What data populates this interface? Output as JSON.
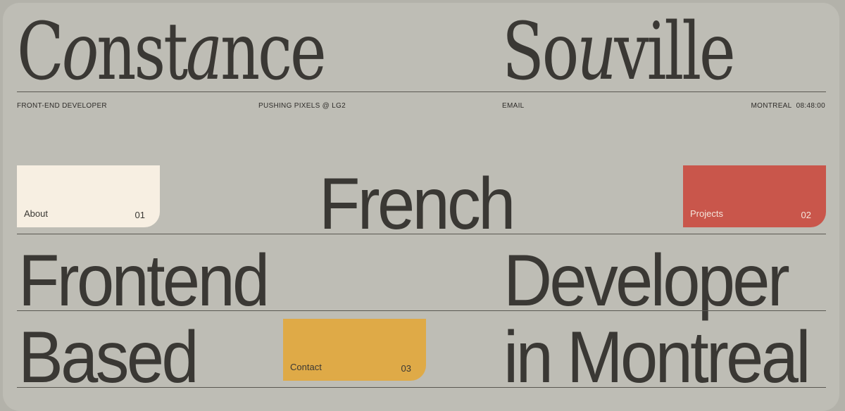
{
  "header": {
    "first_name": {
      "upright_start": "C",
      "italic_a": "o",
      "upright_mid": "nst",
      "italic_b": "a",
      "upright_end": "nce"
    },
    "last_name": {
      "upright_start": "So",
      "italic_a": "u",
      "upright_end": "ville"
    }
  },
  "info_bar": {
    "role": "FRONT-END DEVELOPER",
    "tagline": "PUSHING PIXELS @ LG2",
    "email": "EMAIL",
    "location": "MONTREAL",
    "clock": "08:48:00"
  },
  "headline": {
    "line1": "French",
    "line2_left": "Frontend",
    "line2_right": "Developer",
    "line3_left": "Based",
    "line3_right": "in Montreal"
  },
  "nav_cards": {
    "about": {
      "label": "About",
      "number": "01",
      "color": "#f7efe2"
    },
    "projects": {
      "label": "Projects",
      "number": "02",
      "color": "#c9564b"
    },
    "contact": {
      "label": "Contact",
      "number": "03",
      "color": "#dfaa47"
    }
  },
  "theme": {
    "background": "#bebdb5",
    "text": "#3a3834"
  }
}
